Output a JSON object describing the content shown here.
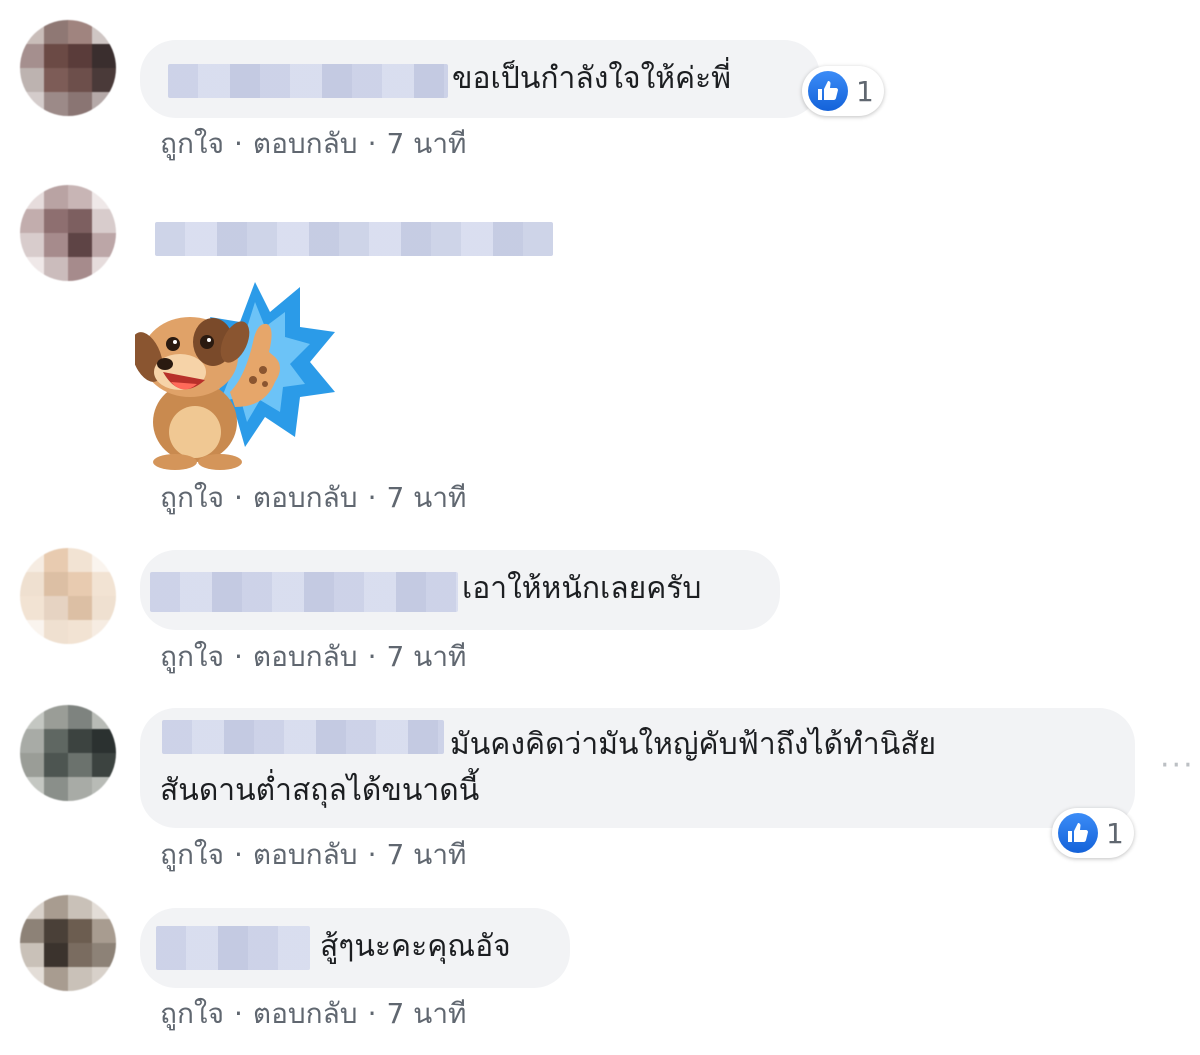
{
  "comments": [
    {
      "text": "ขอเป็นกำลังใจให้ค่ะพี่",
      "actions": {
        "like": "ถูกใจ",
        "reply": "ตอบกลับ",
        "time": "7 นาที",
        "separator": "·"
      },
      "reaction_count": "1",
      "avatar_colors": [
        "#bdb3b0",
        "#6b4a45",
        "#9c8a88",
        "#3a2e2e",
        "#a58f8e",
        "#5a3c3a"
      ]
    },
    {
      "sticker": "puppy-thumbs-up-sticker",
      "actions": {
        "like": "ถูกใจ",
        "reply": "ตอบกลับ",
        "time": "7 นาที",
        "separator": "·"
      },
      "avatar_colors": [
        "#d8cccc",
        "#8e6f70",
        "#b9a3a3",
        "#5e4445",
        "#a68b8c",
        "#e6dcdc"
      ]
    },
    {
      "text": "เอาให้หนักเลยครับ",
      "actions": {
        "like": "ถูกใจ",
        "reply": "ตอบกลับ",
        "time": "7 นาที",
        "separator": "·"
      },
      "avatar_colors": [
        "#f2e3d3",
        "#e8cbb0",
        "#f6ece2",
        "#dcbfa4",
        "#efe0d0",
        "#e6d3c2"
      ]
    },
    {
      "text_line1": "มันคงคิดว่ามันใหญ่คับฟ้าถึงได้ทำนิสัย",
      "text_line2": "สันดานต่ำสถุลได้ขนาดนี้",
      "actions": {
        "like": "ถูกใจ",
        "reply": "ตอบกลับ",
        "time": "7 นาที",
        "separator": "·"
      },
      "reaction_count": "1",
      "avatar_colors": [
        "#9a9d97",
        "#3c4340",
        "#c4c7c2",
        "#5f6762",
        "#2b3130",
        "#a8aba6"
      ]
    },
    {
      "text": "สู้ๆนะคะคุณอัจ",
      "actions": {
        "like": "ถูกใจ",
        "reply": "ตอบกลับ",
        "time": "7 นาที",
        "separator": "·"
      },
      "avatar_colors": [
        "#c9c1b8",
        "#4a4038",
        "#8d8277",
        "#6c5d50",
        "#a89c90",
        "#3b332d"
      ]
    }
  ],
  "icons": {
    "like": "like-thumb-icon",
    "more": "more-options-icon"
  },
  "more_label": "···",
  "colors": {
    "bubble": "#f2f3f5",
    "like_blue": "#1877f2",
    "meta_text": "#606770"
  }
}
